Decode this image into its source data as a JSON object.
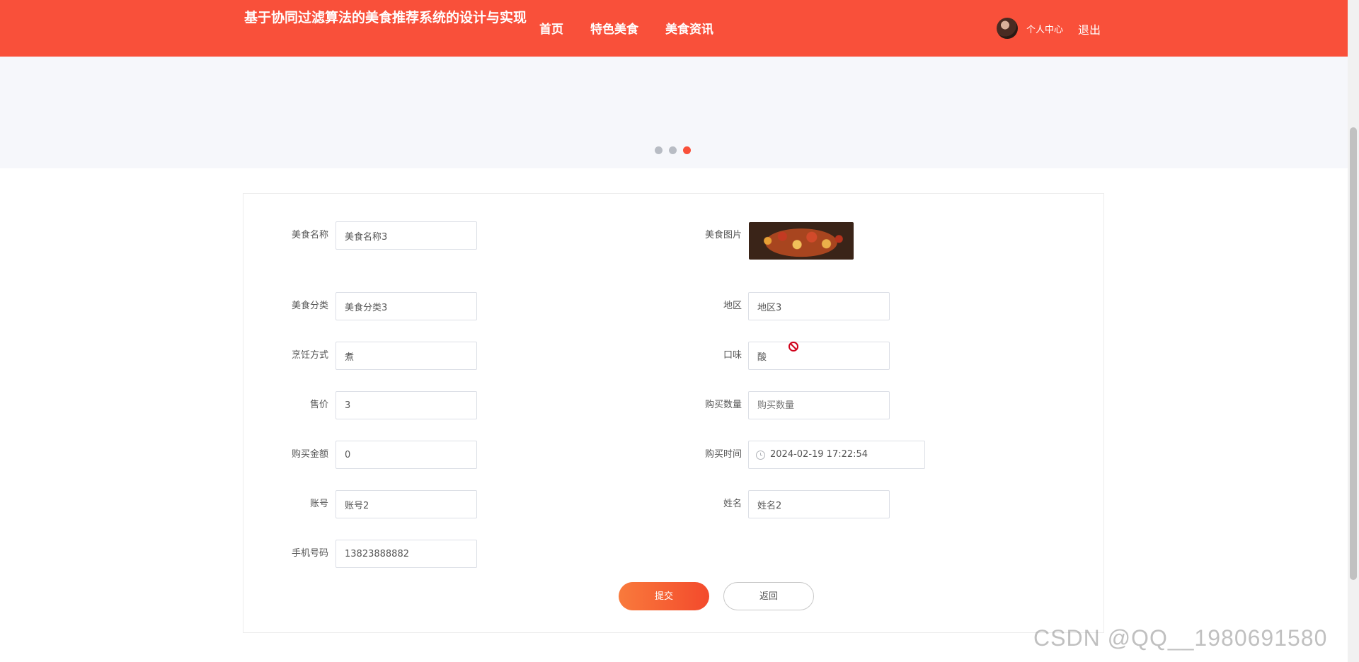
{
  "header": {
    "site_title": "基于协同过滤算法的美食推荐系统的设计与实现",
    "nav": [
      "首页",
      "特色美食",
      "美食资讯"
    ],
    "user_center": "个人中心",
    "logout": "退出"
  },
  "banner": {
    "dots": 3,
    "active_dot": 3
  },
  "form": {
    "food_name": {
      "label": "美食名称",
      "value": "美食名称3"
    },
    "food_image": {
      "label": "美食图片"
    },
    "category": {
      "label": "美食分类",
      "value": "美食分类3"
    },
    "region": {
      "label": "地区",
      "value": "地区3"
    },
    "cooking": {
      "label": "烹饪方式",
      "value": "煮"
    },
    "taste": {
      "label": "口味",
      "value": "酸"
    },
    "price": {
      "label": "售价",
      "value": "3"
    },
    "quantity": {
      "label": "购买数量",
      "value": "",
      "placeholder": "购买数量"
    },
    "amount": {
      "label": "购买金额",
      "value": "0"
    },
    "time": {
      "label": "购买时间",
      "value": "2024-02-19 17:22:54"
    },
    "account": {
      "label": "账号",
      "value": "账号2"
    },
    "name": {
      "label": "姓名",
      "value": "姓名2"
    },
    "phone": {
      "label": "手机号码",
      "value": "13823888882"
    }
  },
  "buttons": {
    "submit": "提交",
    "back": "返回"
  },
  "watermark": "CSDN @QQ__1980691580",
  "colors": {
    "brand": "#f9503a",
    "banner_bg": "#f6f7fb"
  }
}
